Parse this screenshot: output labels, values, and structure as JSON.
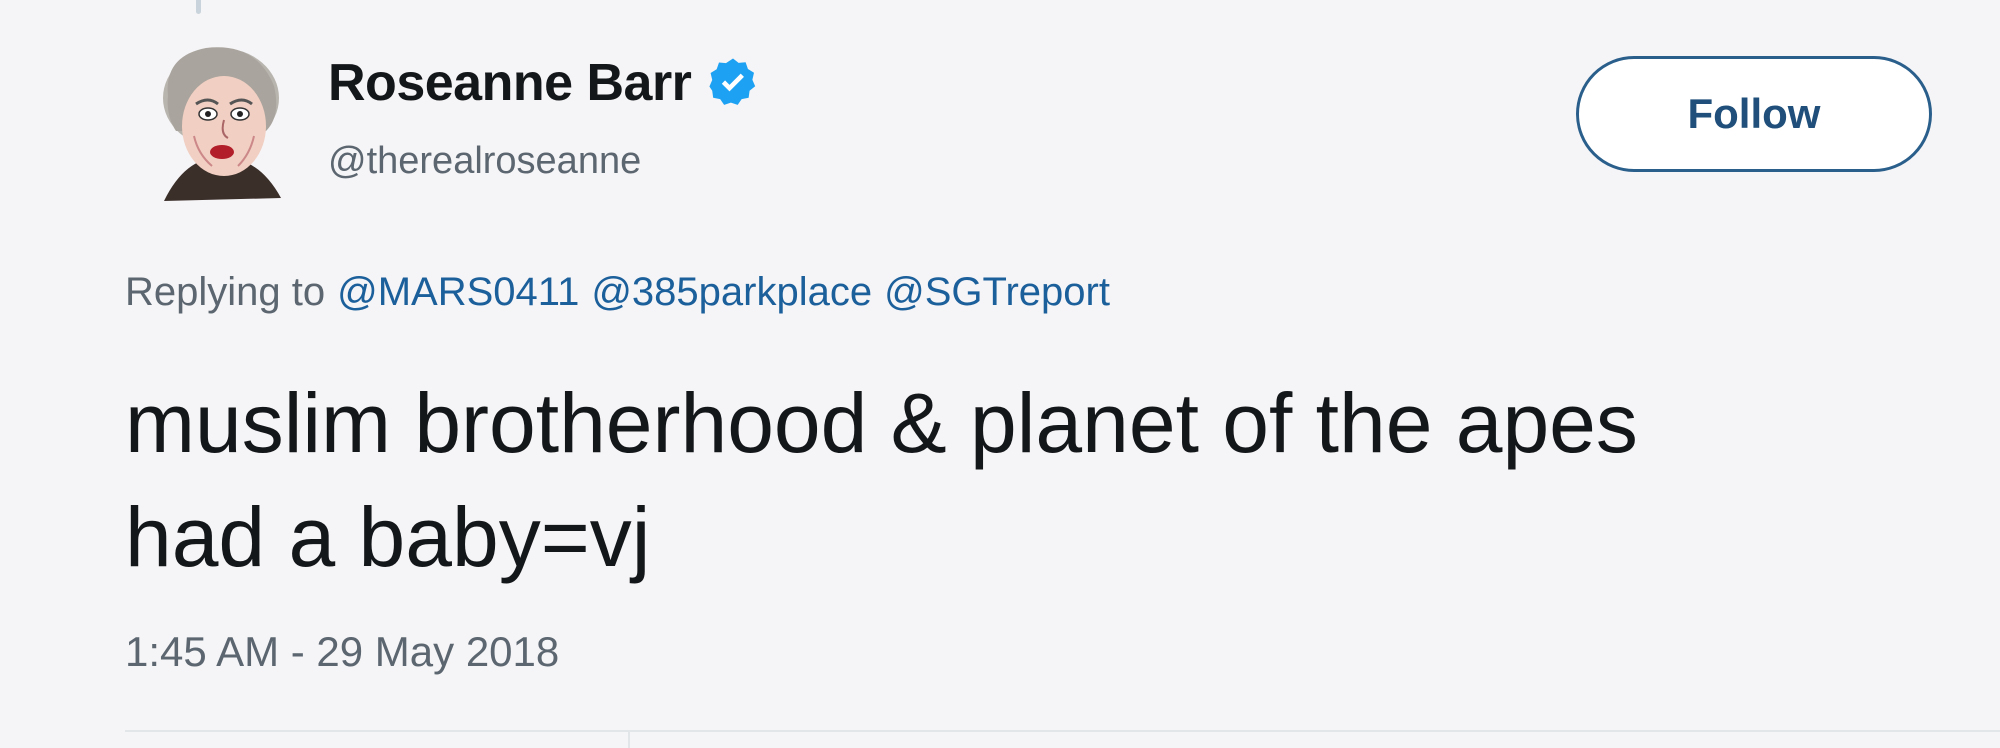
{
  "tweet": {
    "author": {
      "display_name": "Roseanne Barr",
      "handle": "@therealroseanne",
      "verified": true,
      "avatar_icon": "cartoon-portrait-avatar"
    },
    "follow_button_label": "Follow",
    "replying_to_label": "Replying to",
    "mentions": [
      "@MARS0411",
      "@385parkplace",
      "@SGTreport"
    ],
    "text_line_1": "muslim brotherhood & planet of the apes",
    "text_line_2": "had a baby=vj",
    "timestamp": "1:45 AM - 29 May 2018"
  },
  "colors": {
    "background": "#f5f4f6",
    "link": "#1b5f9b",
    "verified": "#1da1f2",
    "secondary_text": "#5b6670",
    "primary_text": "#14171a"
  }
}
